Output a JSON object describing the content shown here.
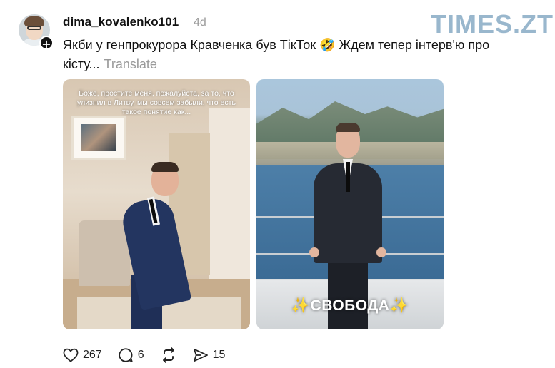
{
  "post": {
    "username": "dima_kovalenko101",
    "time_ago": "4d",
    "caption": "Якби у генпрокурора Кравченка був ТікТок 🤣 Ждем тепер інтерв'ю про кісту...",
    "translate_label": "Translate"
  },
  "watermark": "TIMES.ZT",
  "media": [
    {
      "overlay_text": "Боже, простите меня, пожалуйста, за то, что улизнил в Литву, мы совсем забыли, что есть такое понятие как..."
    },
    {
      "overlay_text": "✨СВОБОДА✨"
    }
  ],
  "actions": {
    "likes": "267",
    "comments": "6",
    "shares": "15"
  },
  "icons": [
    "heart-icon",
    "comment-icon",
    "repost-icon",
    "send-icon",
    "plus-icon"
  ]
}
